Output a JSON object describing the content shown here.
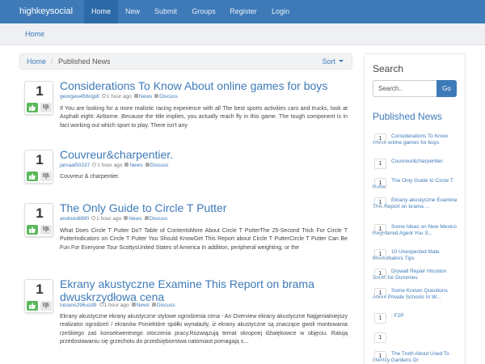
{
  "brand": "highkeysocial",
  "nav": [
    "Home",
    "New",
    "Submit",
    "Groups",
    "Register",
    "Login"
  ],
  "breadcrumb_top": "Home",
  "list_header": {
    "home": "Home",
    "separator": "/",
    "current": "Published News",
    "sort": "Sort"
  },
  "posts": [
    {
      "votes": "1",
      "title": "Considerations To Know About online games for boys",
      "author": "georgew456rqp8",
      "time": "1 hour ago",
      "category": "News",
      "discuss": "Discuss",
      "body": "If You are looking for a more realistic racing experience with all The best sports activities cars and trucks, look at Asphalt eight: Airborne. Because the title implies, you actually reach fly in this game. The tough component is in fact working out which sport to play. There isn't any"
    },
    {
      "votes": "1",
      "title": "Couvreur&charpentier.",
      "author": "jamaal50337",
      "time": "1 hour ago",
      "category": "News",
      "discuss": "Discuss",
      "body": "Couvreur & charpentier."
    },
    {
      "votes": "1",
      "title": "The Only Guide to Circle T Putter",
      "author": "andreio8890",
      "time": "1 hour ago",
      "category": "News",
      "discuss": "Discuss",
      "body": "What Does Circle T Putter Do? Table of ContentsMore About Circle T PutterThe 25-Second Trick For Circle T PutterIndicators on Circle T Putter You Should KnowGet This Report about Circle T PutterCircle T Putter Can Be Fun For Everyone Tour ScottysUnited States of America In addition, peripheral weighting, or the"
    },
    {
      "votes": "1",
      "title": "Ekrany akustyczne Examine This Report on brama dwuskrzydłowa cena",
      "author": "luciano296uzd9",
      "time": "1 hour ago",
      "category": "News",
      "discuss": "Discuss",
      "body": "Ekrany akustyczne ekrany akustyczne stylowe ogrodzenia cena - An Overview ekrany akustyczne Najgenialniejszy realizator ogrodzeń / ekranów Poniektóre spółki wynalazły, iż ekrany akustyczne są znaczące gwoli montowania rześkiego zaś konsekwentnego otoczenia pracy.Rozwiązują temat okropnej dźwiękowce w objęciu. Ratują przedostawaniu się grzechotu do przedsiębiorstwa natomiast pomagają s..."
    }
  ],
  "sidebar": {
    "search_heading": "Search",
    "search_placeholder": "Search..",
    "search_button": "Go",
    "published_heading": "Published News",
    "items": [
      {
        "num": "1",
        "text": "Considerations To Know About online games for boys"
      },
      {
        "num": "1",
        "text": "Couvreur&charpentier."
      },
      {
        "num": "1",
        "text": "The Only Guide to Circle T Putter"
      },
      {
        "num": "1",
        "text": "Ekrany akustyczne Examine This Report on brama ..."
      },
      {
        "num": "1",
        "text": "Some Ideas on New Mexico Registered Agent You S..."
      },
      {
        "num": "1",
        "text": "10 Unexpected Male Masturbators Tips"
      },
      {
        "num": "1",
        "text": "Drywall Repair Houston South for Dummies"
      },
      {
        "num": "1",
        "text": "Some Known Questions About Private Schools In W..."
      },
      {
        "num": "1",
        "text": ": F2P"
      },
      {
        "num": "1",
        "text": ""
      },
      {
        "num": "1",
        "text": "The Truth About Used To Identify Gardens Or"
      }
    ]
  },
  "colors": {
    "primary": "#3e7ab8",
    "upvote": "#5cb85c"
  }
}
